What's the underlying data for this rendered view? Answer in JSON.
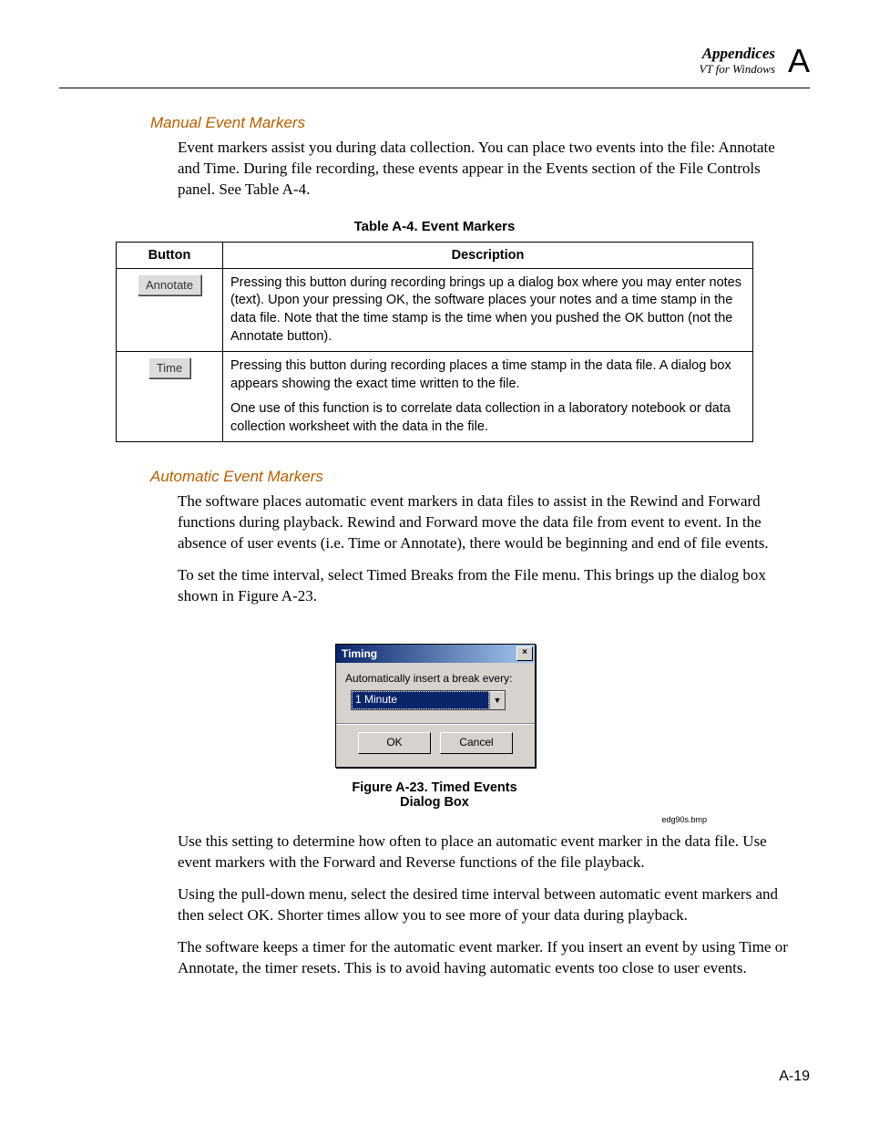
{
  "header": {
    "title": "Appendices",
    "subtitle": "VT for Windows",
    "letter": "A"
  },
  "section1": {
    "heading": "Manual Event Markers",
    "para1": "Event markers assist you during data collection. You can place two events into the file: Annotate and Time. During file recording, these events appear in the Events section of the File Controls panel. See Table A-4."
  },
  "table": {
    "caption": "Table A-4. Event Markers",
    "col_button": "Button",
    "col_desc": "Description",
    "rows": [
      {
        "button": "Annotate",
        "desc": [
          "Pressing this button during recording brings up a dialog box where you may enter notes (text). Upon your pressing OK, the software places your notes and a time stamp in the data file. Note that the time stamp is the time when you pushed the OK button (not the Annotate button)."
        ]
      },
      {
        "button": "Time",
        "desc": [
          "Pressing this button during recording places a time stamp in the data file. A dialog box appears showing the exact time written to the file.",
          "One use of this function is to correlate data collection in a laboratory notebook or data collection worksheet with the data in the file."
        ]
      }
    ]
  },
  "section2": {
    "heading": "Automatic Event Markers",
    "para1": "The software places automatic event markers in data files to assist in the Rewind and Forward functions during playback. Rewind and Forward move the data file from event to event. In the absence of user events (i.e. Time or Annotate), there would be beginning and end of file events.",
    "para2": "To set the time interval, select Timed Breaks from the File menu. This brings up the dialog box shown in Figure A-23."
  },
  "figure": {
    "dialog_title": "Timing",
    "label": "Automatically insert a break every:",
    "combo_value": "1 Minute",
    "ok": "OK",
    "cancel": "Cancel",
    "caption": "Figure A-23. Timed Events Dialog Box",
    "filename": "edg90s.bmp"
  },
  "section3": {
    "para1": "Use this setting to determine how often to place an automatic event marker in the data file. Use event markers with the Forward and Reverse functions of the file playback.",
    "para2": "Using the pull-down menu, select the desired time interval between automatic event markers and then select OK. Shorter times allow you to see more of your data during playback.",
    "para3": "The software keeps a timer for the automatic event marker. If you insert an event by using Time or Annotate, the timer resets. This is to avoid having automatic events too close to user events."
  },
  "page_number": "A-19"
}
